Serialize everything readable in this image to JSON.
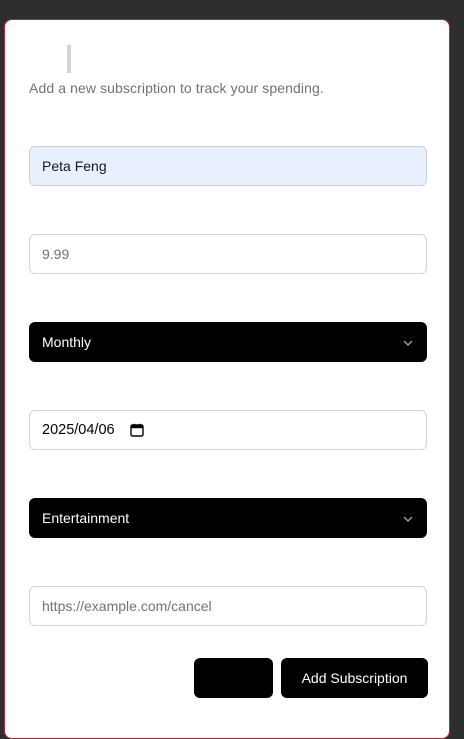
{
  "dialog": {
    "title": "",
    "description": "Add a new subscription to track your spending."
  },
  "form": {
    "name": {
      "value": "Peta Feng",
      "placeholder": ""
    },
    "price": {
      "value": "",
      "placeholder": "9.99"
    },
    "billing_cycle": {
      "selected": "Monthly"
    },
    "next_billing_date": {
      "value": "2025/04/06"
    },
    "category": {
      "selected": "Entertainment"
    },
    "cancellation_url": {
      "value": "",
      "placeholder": "https://example.com/cancel"
    }
  },
  "actions": {
    "cancel_label": "",
    "submit_label": "Add Subscription"
  },
  "colors": {
    "accent_border": "#c81e3a",
    "autofill_bg": "#e8f0fe",
    "button_bg": "#000000"
  },
  "icons": {
    "select_chevron": "chevron-down-icon",
    "date_picker": "calendar-icon"
  }
}
